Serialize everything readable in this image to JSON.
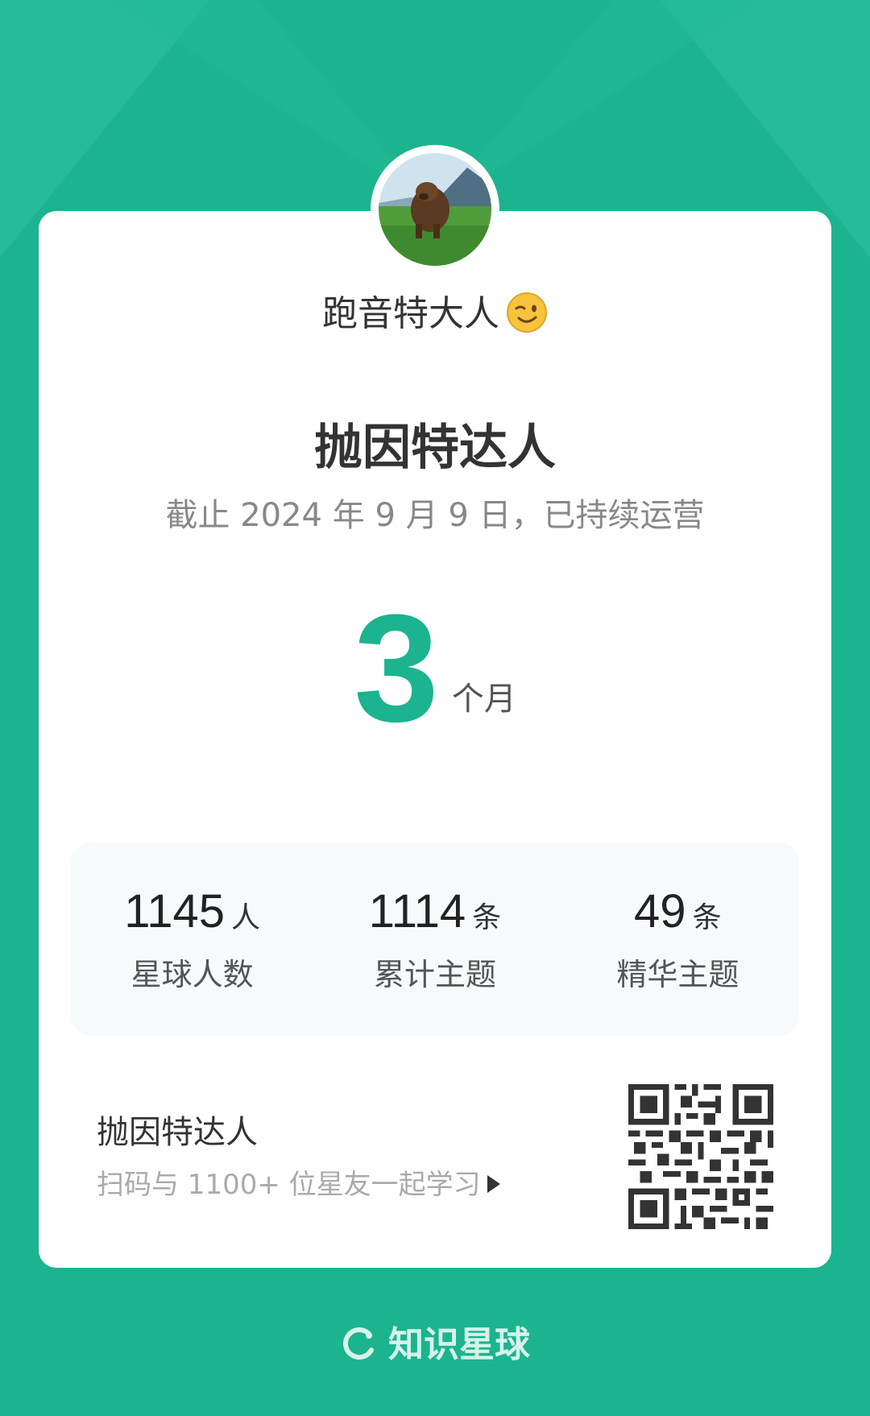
{
  "owner": {
    "name": "跑音特大人",
    "emoji": "winking-face"
  },
  "planet": {
    "title": "抛因特达人",
    "since_text": "截止 2024 年 9 月 9 日，已持续运营",
    "duration_value": "3",
    "duration_unit": "个月"
  },
  "stats": [
    {
      "value": "1145",
      "unit": "人",
      "label": "星球人数"
    },
    {
      "value": "1114",
      "unit": "条",
      "label": "累计主题"
    },
    {
      "value": "49",
      "unit": "条",
      "label": "精华主题"
    }
  ],
  "footer": {
    "name": "抛因特达人",
    "hint": "扫码与 1100+ 位星友一起学习"
  },
  "brand": {
    "name": "知识星球"
  },
  "colors": {
    "accent": "#1bb48f",
    "card": "#ffffff",
    "stats_bg": "#f6fafa",
    "text_dark": "#333333",
    "text_muted": "#888888"
  }
}
